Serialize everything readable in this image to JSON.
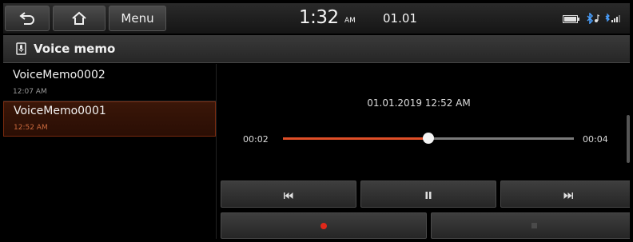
{
  "statusbar": {
    "back_icon": "back-arrow-icon",
    "home_icon": "home-icon",
    "menu_label": "Menu",
    "time": "1:32",
    "ampm": "AM",
    "date": "01.01",
    "icons": [
      "battery-icon",
      "bluetooth-audio-icon",
      "phone-signal-icon"
    ]
  },
  "titlebar": {
    "icon": "voice-memo-icon",
    "title": "Voice memo"
  },
  "memos": [
    {
      "name": "VoiceMemo0002",
      "time": "12:07 AM",
      "selected": false
    },
    {
      "name": "VoiceMemo0001",
      "time": "12:52 AM",
      "selected": true
    }
  ],
  "player": {
    "recorded_at": "01.01.2019 12:52 AM",
    "elapsed": "00:02",
    "total": "00:04",
    "progress_fraction": 0.5,
    "accent_color": "#e04f28"
  },
  "controls": {
    "prev_icon": "skip-previous-icon",
    "pause_icon": "pause-icon",
    "next_icon": "skip-next-icon",
    "record_icon": "record-icon",
    "record_color": "#e0281a",
    "stop_icon": "stop-icon"
  }
}
